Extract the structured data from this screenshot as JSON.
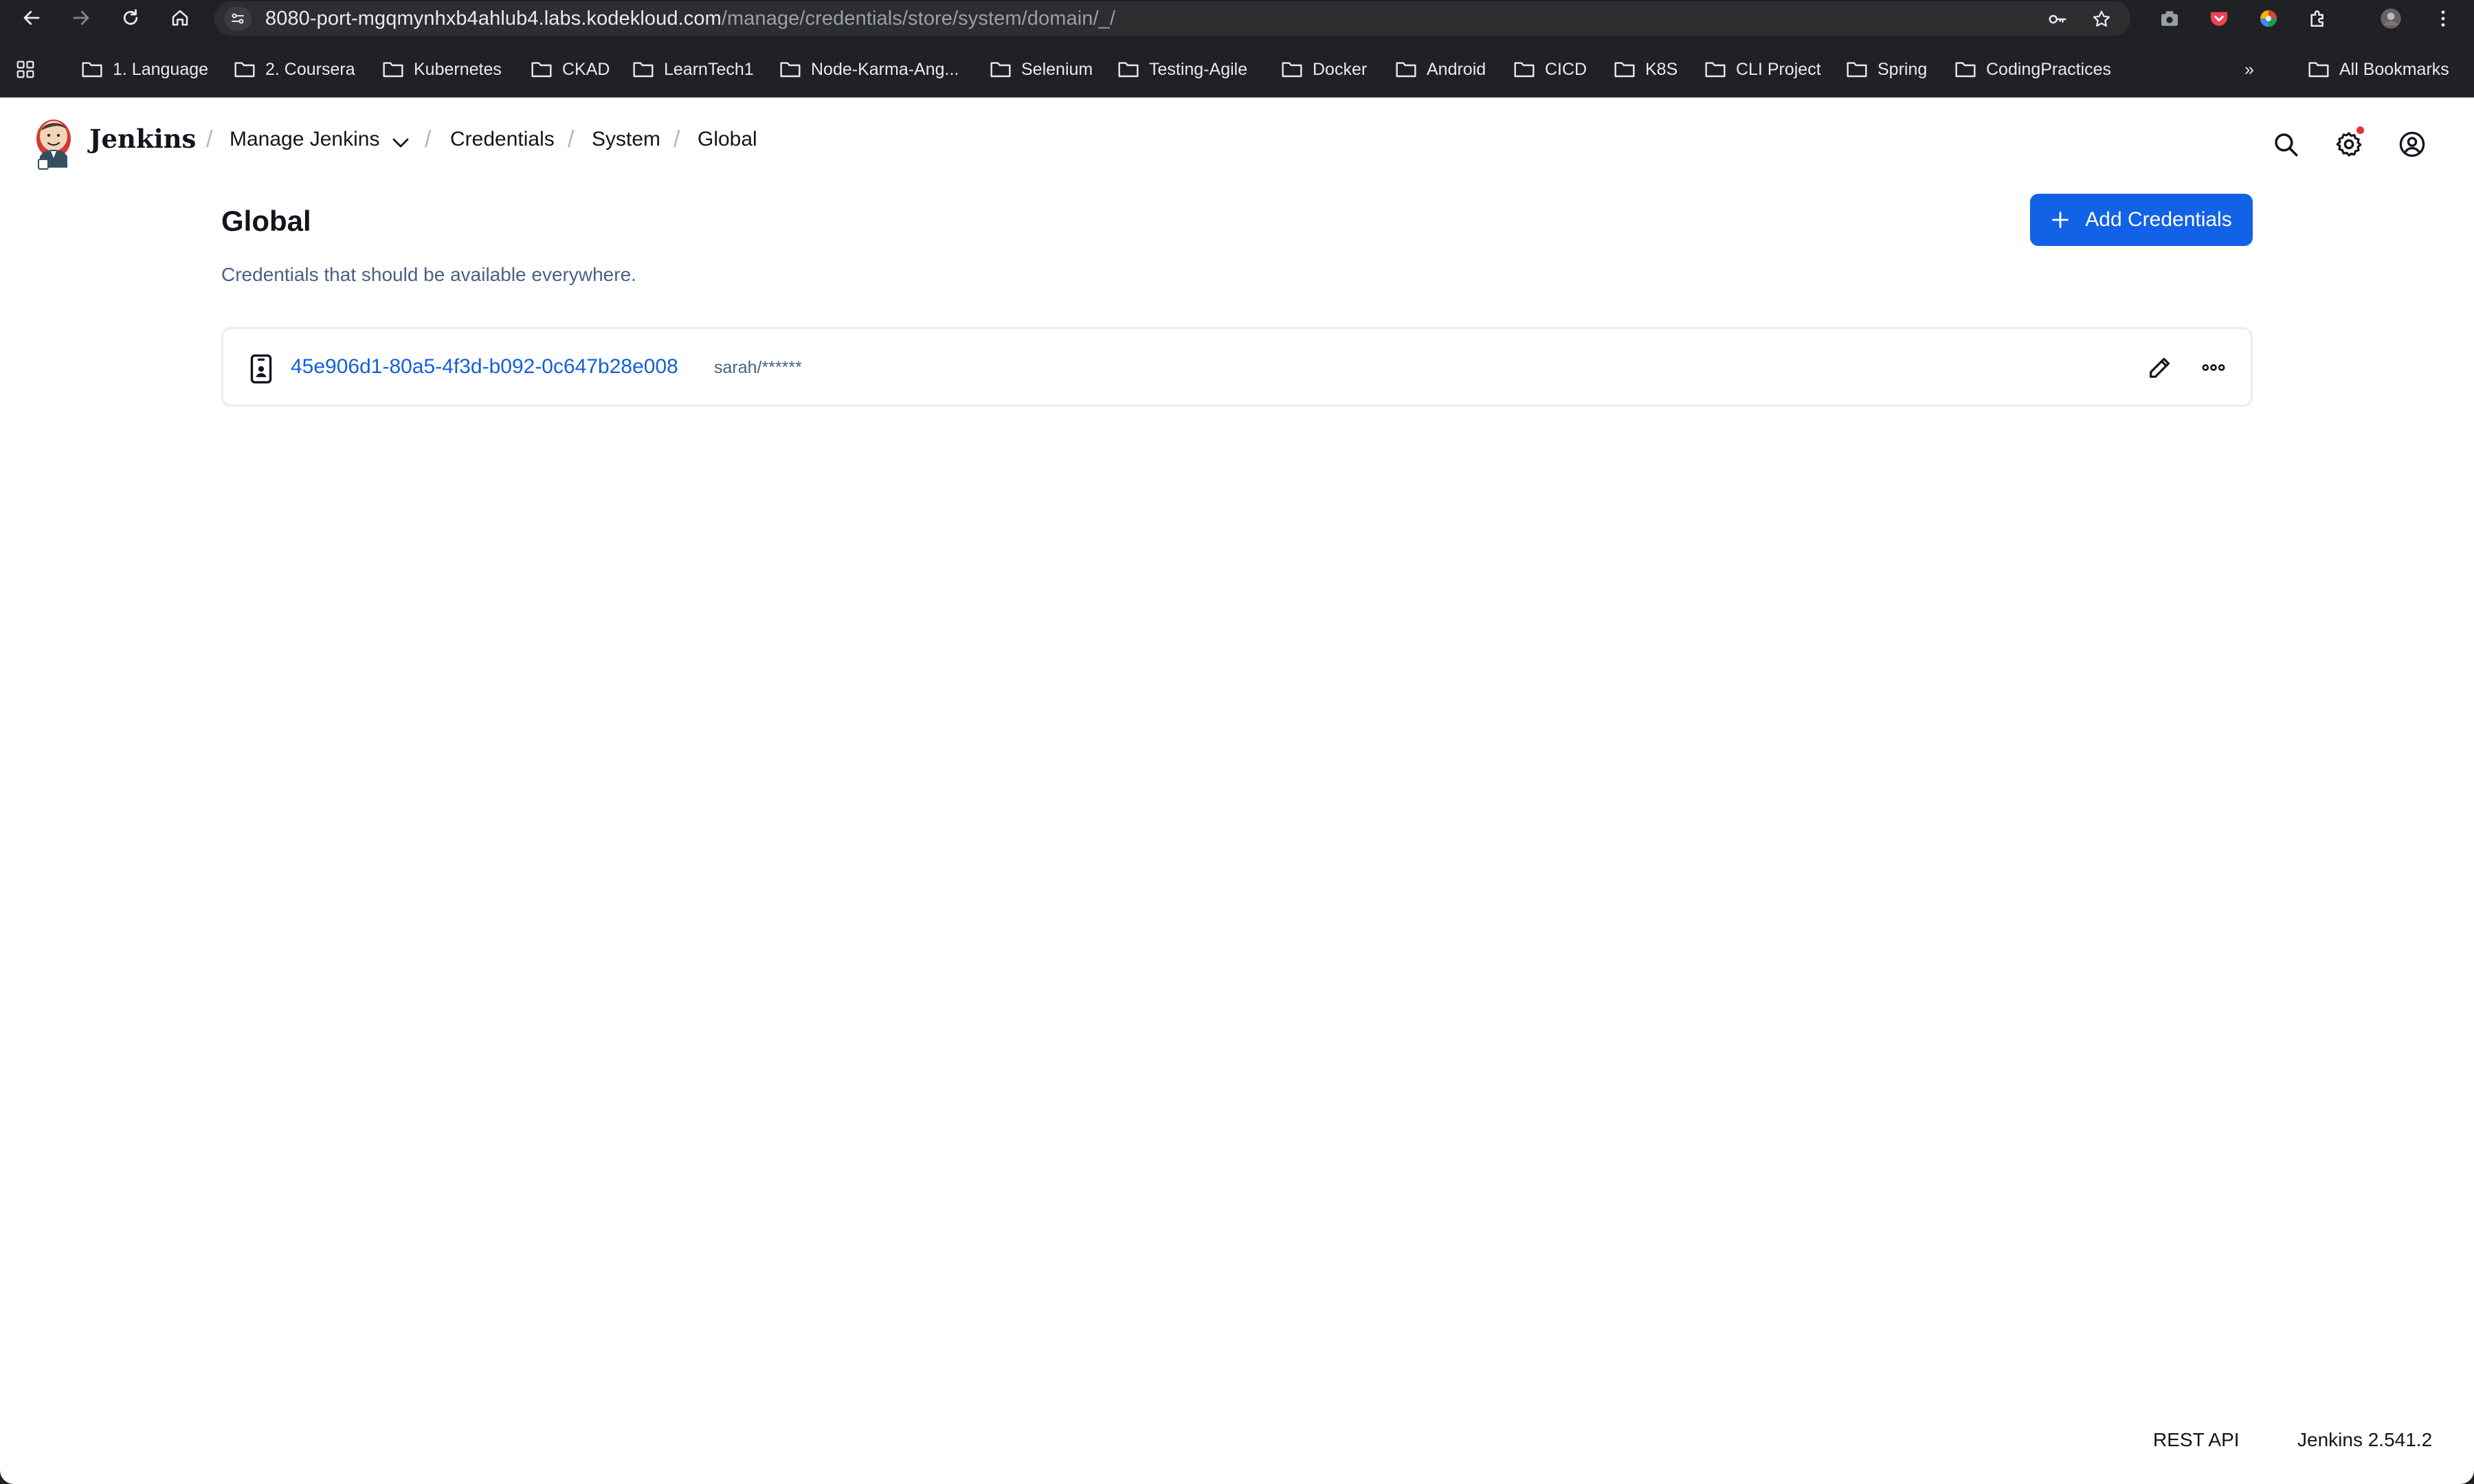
{
  "browser": {
    "url_host": "8080-port-mgqmynhxb4ahlub4.labs.kodekloud.com",
    "url_path": "/manage/credentials/store/system/domain/_/",
    "bookmarks": [
      "1. Language",
      "2. Coursera",
      "Kubernetes",
      "CKAD",
      "LearnTech1",
      "Node-Karma-Ang...",
      "Selenium",
      "Testing-Agile",
      "Docker",
      "Android",
      "CICD",
      "K8S",
      "CLI Project",
      "Spring",
      "CodingPractices"
    ],
    "more_bookmarks": "»",
    "all_bookmarks": "All Bookmarks"
  },
  "header": {
    "brand": "Jenkins",
    "breadcrumbs": [
      "Manage Jenkins",
      "Credentials",
      "System",
      "Global"
    ],
    "breadcrumb_separator": "/"
  },
  "main": {
    "title": "Global",
    "description": "Credentials that should be available everywhere.",
    "add_button_label": "Add Credentials",
    "credentials": [
      {
        "id": "45e906d1-80a5-4f3d-b092-0c647b28e008",
        "name": "sarah/******"
      }
    ]
  },
  "footer": {
    "rest_api": "REST API",
    "version": "Jenkins 2.541.2"
  },
  "colors": {
    "accent": "#1262e8",
    "link": "#1460d8",
    "notification": "#e63535"
  }
}
